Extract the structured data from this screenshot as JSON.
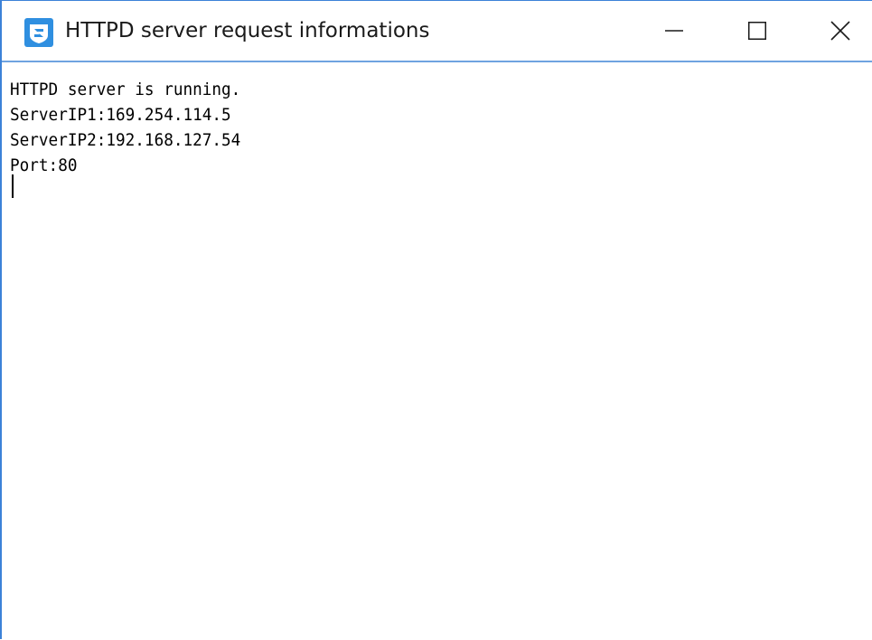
{
  "window": {
    "title": "HTTPD server request informations",
    "app_icon": "app-logo-icon",
    "accent_color": "#3c82d8",
    "controls": {
      "minimize_icon": "minimize-icon",
      "maximize_icon": "maximize-icon",
      "close_icon": "close-icon"
    }
  },
  "console": {
    "lines": [
      "HTTPD server is running.",
      "ServerIP1:169.254.114.5",
      "ServerIP2:192.168.127.54",
      "Port:80"
    ]
  }
}
